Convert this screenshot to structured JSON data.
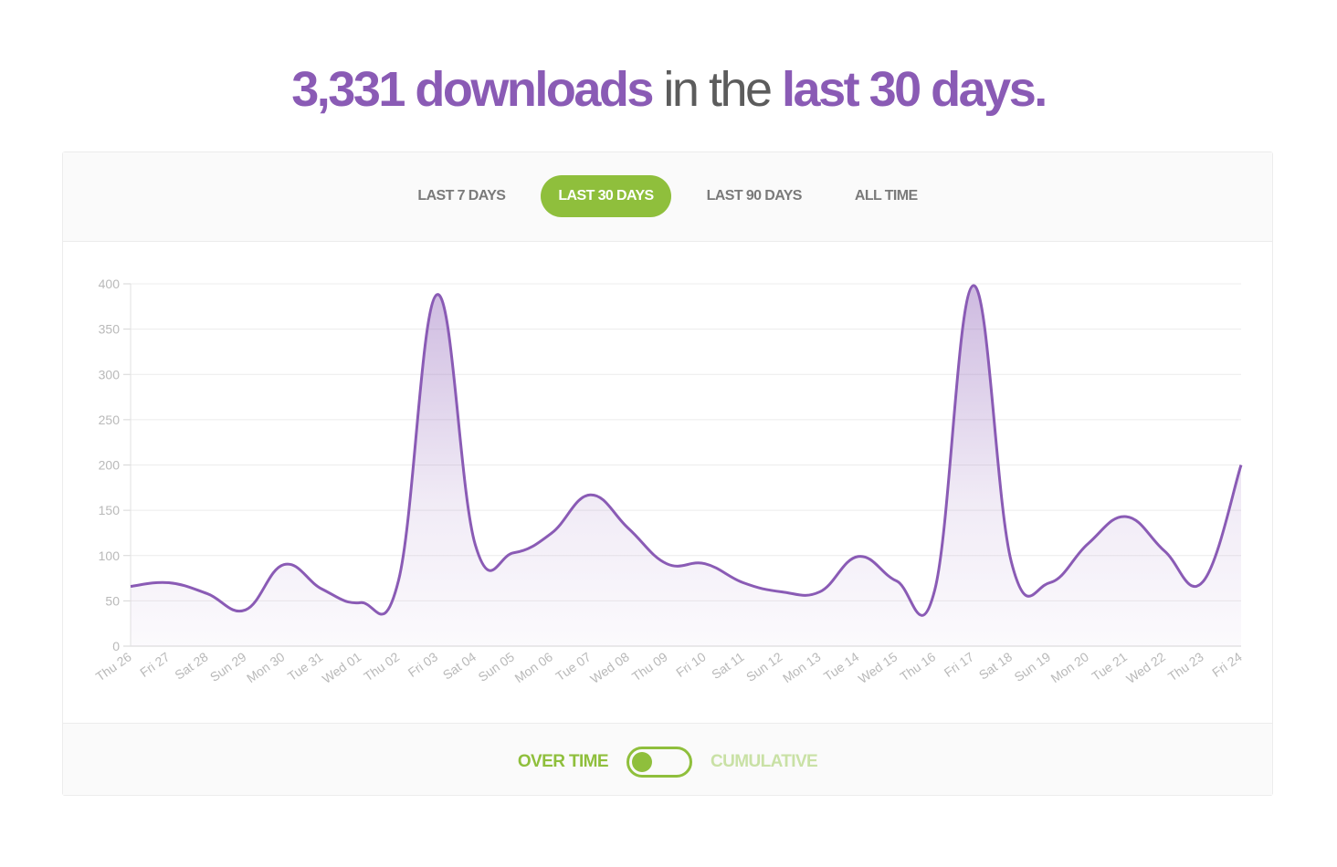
{
  "headline": {
    "count": "3,331 downloads",
    "middle": "in the",
    "period": "last 30 days."
  },
  "tabs": [
    {
      "label": "LAST 7 DAYS",
      "active": false
    },
    {
      "label": "LAST 30 DAYS",
      "active": true
    },
    {
      "label": "LAST 90 DAYS",
      "active": false
    },
    {
      "label": "ALL TIME",
      "active": false
    }
  ],
  "toggle": {
    "left_label": "OVER TIME",
    "right_label": "CUMULATIVE",
    "state": "over-time"
  },
  "colors": {
    "accent_purple": "#8a5bb5",
    "accent_green": "#8fbf3c",
    "line": "#8a5bb5"
  },
  "chart_data": {
    "type": "area",
    "title": "",
    "xlabel": "",
    "ylabel": "",
    "ylim": [
      0,
      400
    ],
    "yticks": [
      0,
      50,
      100,
      150,
      200,
      250,
      300,
      350,
      400
    ],
    "grid": true,
    "legend": "none",
    "categories": [
      "Thu 26",
      "Fri 27",
      "Sat 28",
      "Sun 29",
      "Mon 30",
      "Tue 31",
      "Wed 01",
      "Thu 02",
      "Fri 03",
      "Sat 04",
      "Sun 05",
      "Mon 06",
      "Tue 07",
      "Wed 08",
      "Thu 09",
      "Fri 10",
      "Sat 11",
      "Sun 12",
      "Mon 13",
      "Tue 14",
      "Wed 15",
      "Thu 16",
      "Fri 17",
      "Sat 18",
      "Sun 19",
      "Mon 20",
      "Tue 21",
      "Wed 22",
      "Thu 23",
      "Fri 24"
    ],
    "series": [
      {
        "name": "Downloads",
        "values": [
          66,
          70,
          58,
          40,
          90,
          63,
          48,
          73,
          388,
          112,
          103,
          125,
          167,
          130,
          91,
          91,
          70,
          60,
          60,
          99,
          72,
          62,
          398,
          93,
          70,
          113,
          143,
          105,
          71,
          200
        ]
      }
    ]
  }
}
